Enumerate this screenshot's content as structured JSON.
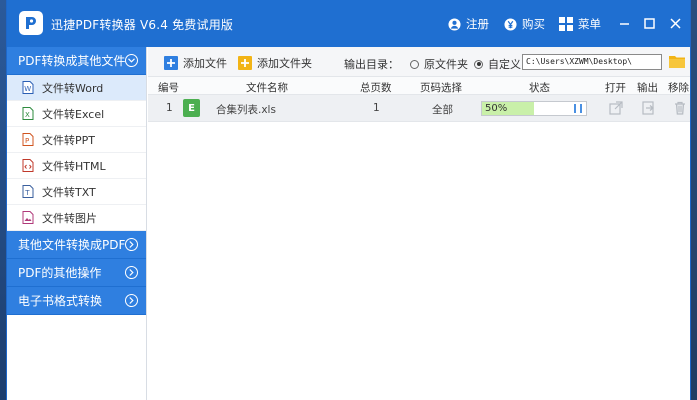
{
  "app": {
    "title": "迅捷PDF转换器 V6.4 免费试用版",
    "register_label": "注册",
    "buy_label": "购买",
    "menu_label": "菜单"
  },
  "sidebar": {
    "sections": [
      {
        "label": "PDF转换成其他文件",
        "expanded": true
      },
      {
        "label": "其他文件转换成PDF",
        "expanded": false
      },
      {
        "label": "PDF的其他操作",
        "expanded": false
      },
      {
        "label": "电子书格式转换",
        "expanded": false
      }
    ],
    "items": [
      {
        "label": "文件转Word",
        "icon": "word-icon",
        "active": true
      },
      {
        "label": "文件转Excel",
        "icon": "excel-icon"
      },
      {
        "label": "文件转PPT",
        "icon": "ppt-icon"
      },
      {
        "label": "文件转HTML",
        "icon": "html-icon"
      },
      {
        "label": "文件转TXT",
        "icon": "txt-icon"
      },
      {
        "label": "文件转图片",
        "icon": "image-icon"
      }
    ]
  },
  "toolbar": {
    "add_file_label": "添加文件",
    "add_folder_label": "添加文件夹",
    "output_dir_label": "输出目录：",
    "radio_original_label": "原文件夹",
    "radio_custom_label": "自定义",
    "selected_radio": "自定义",
    "output_path": "C:\\Users\\XZWM\\Desktop\\"
  },
  "table": {
    "headers": {
      "index": "编号",
      "filename": "文件名称",
      "pages": "总页数",
      "page_select": "页码选择",
      "status": "状态",
      "open": "打开",
      "output": "输出",
      "remove": "移除"
    },
    "rows": [
      {
        "index": "1",
        "file_icon": "E",
        "filename": "合集列表.xls",
        "pages": "1",
        "page_select": "全部",
        "progress_text": "50%",
        "progress_fraction": 0.5
      }
    ]
  },
  "colors": {
    "title_bar": "#1f6fd1",
    "sidebar_header": "#2f7fe0",
    "progress_fill": "#c9f0a9",
    "file_icon": "#4caf50"
  }
}
